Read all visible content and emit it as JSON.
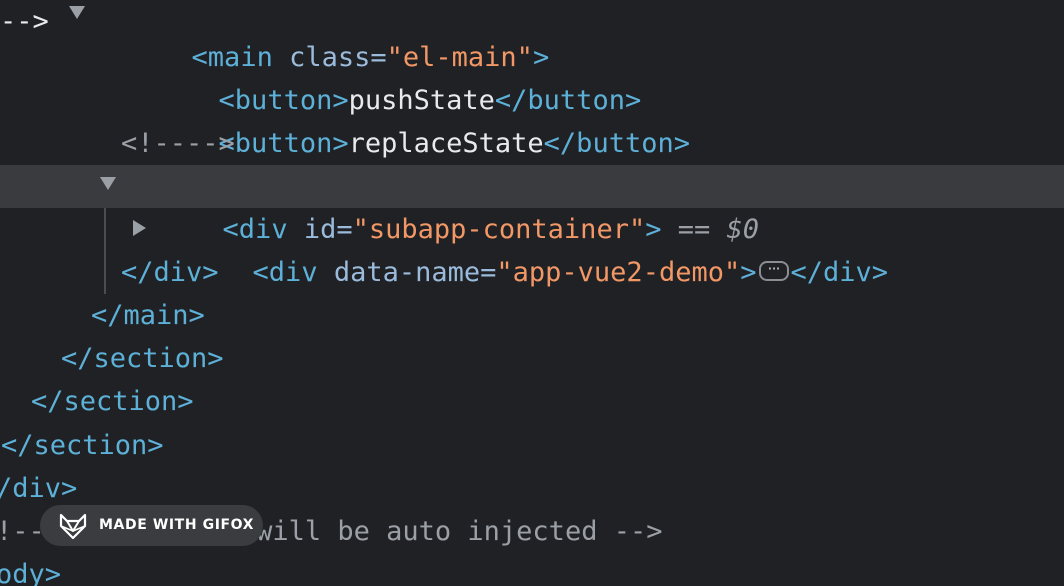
{
  "colors": {
    "background": "#202124",
    "selected_row": "#3a3b3e",
    "tag": "#5db0d7",
    "attribute_name": "#9bbbdc",
    "attribute_value": "#f29766",
    "text": "#e8eaed",
    "comment": "#9aa0a6"
  },
  "lines": {
    "main_open": {
      "open": "<main",
      "attr_name": " class=",
      "attr_value": "\"el-main\"",
      "close": ">"
    },
    "button_push": {
      "open": "<button>",
      "text": "pushState",
      "close": "</button>"
    },
    "button_replace": {
      "open": "<button>",
      "text": "replaceState",
      "close": "</button>"
    },
    "comment_empty": "<!---->",
    "div_container": {
      "open": "<div",
      "attr_name": " id=",
      "attr_value": "\"subapp-container\"",
      "close": ">",
      "console_ref": " == ",
      "console_var": "$0"
    },
    "div_app": {
      "open": "<div",
      "attr_name": " data-name=",
      "attr_value": "\"app-vue2-demo\"",
      "close": ">",
      "ellipsis": "···",
      "end": "</div>"
    },
    "div_close": "</div>",
    "main_close": "</main>",
    "section_close_1": "</section>",
    "section_close_2": "</section>",
    "section_close_3": "</section>",
    "div_close_2": "/div>",
    "comment_injected": "!-- built files will be auto injected -->",
    "body_close": "ody>"
  },
  "badge": {
    "label": "MADE WITH GIFOX",
    "icon": "fox-logo-icon"
  }
}
